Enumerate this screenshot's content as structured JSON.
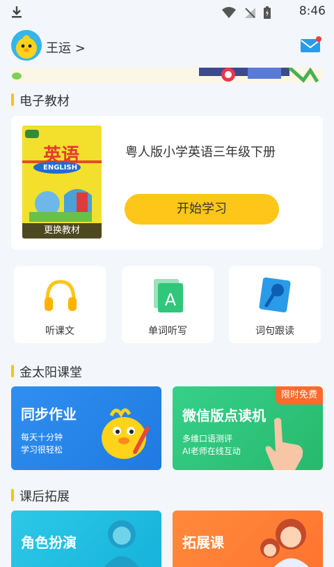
{
  "status_bar": {
    "time": "8:46"
  },
  "user": {
    "name": "王运 >"
  },
  "sections": {
    "textbook": "电子教材",
    "classroom": "金太阳课堂",
    "extension": "课后拓展"
  },
  "textbook": {
    "title": "粤人版小学英语三年级下册",
    "start_label": "开始学习",
    "change_label": "更换教材",
    "cover_title": "英语",
    "cover_subtitle": "ENGLISH"
  },
  "features": [
    {
      "label": "听课文",
      "icon": "headphones-icon"
    },
    {
      "label": "单词听写",
      "icon": "letter-card-icon"
    },
    {
      "label": "词句跟读",
      "icon": "microphone-icon"
    }
  ],
  "classroom_cards": [
    {
      "title": "同步作业",
      "line1": "每天十分钟",
      "line2": "学习很轻松",
      "color": "#2f8ff0"
    },
    {
      "title": "微信版点读机",
      "line1": "多维口语测评",
      "line2": "AI老师在线互动",
      "badge": "限时免费",
      "color": "#2fc77a"
    }
  ],
  "extension_cards": [
    {
      "title": "角色扮演",
      "color": "#22bfe0"
    },
    {
      "title": "拓展课",
      "color": "#ff7f3c"
    }
  ],
  "colors": {
    "accent": "#ffc61a",
    "background": "#f3f7fb",
    "mail": "#2a9be8",
    "notification": "#ff3b3b"
  }
}
